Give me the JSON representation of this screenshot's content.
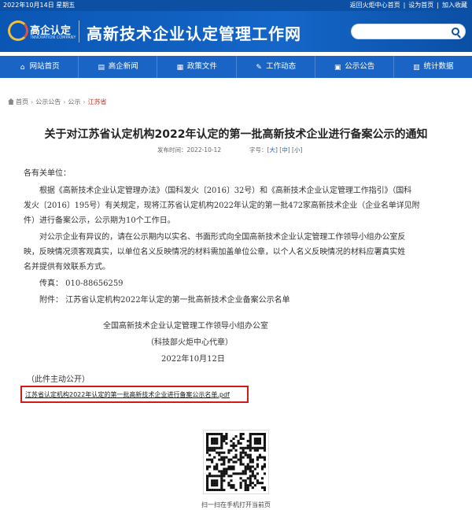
{
  "topbar": {
    "date": "2022年10月14日 星期五",
    "link_home": "返回火炬中心首页",
    "link_sethome": "设为首页",
    "link_favorite": "加入收藏"
  },
  "header": {
    "logo_text": "高企认定",
    "logo_sub": "INNOVATION COMPANY",
    "site_title": "高新技术企业认定管理工作网"
  },
  "nav": [
    {
      "label": "网站首页",
      "icon": "home-icon"
    },
    {
      "label": "高企新闻",
      "icon": "news-icon"
    },
    {
      "label": "政策文件",
      "icon": "document-icon"
    },
    {
      "label": "工作动态",
      "icon": "dynamics-icon"
    },
    {
      "label": "公示公告",
      "icon": "announcement-icon"
    },
    {
      "label": "统计数据",
      "icon": "statistics-icon"
    }
  ],
  "breadcrumb": {
    "home": "首页",
    "level1": "公示公告",
    "level2": "公示",
    "current": "江苏省"
  },
  "article": {
    "title": "关于对江苏省认定机构2022年认定的第一批高新技术企业进行备案公示的通知",
    "publish_label": "发布时间：",
    "publish_time": "2022-10-12",
    "font_label": "字号：",
    "font_large": "大",
    "font_medium": "中",
    "font_small": "小",
    "salutation": "各有关单位：",
    "p1_line1": "根据《高新技术企业认定管理办法》（国科发火〔2016〕32号）和《高新技术企业认定管理工作指引》（国科",
    "p1_line2": "发火〔2016〕195号）有关规定，现将江苏省认定机构2022年认定的第一批472家高新技术企业（企业名单详见附",
    "p1_line3": "件）进行备案公示，公示期为10个工作日。",
    "p2_line1": "对公示企业有异议的，请在公示期内以实名、书面形式向全国高新技术企业认定管理工作领导小组办公室反",
    "p2_line2": "映，反映情况须客观真实，以单位名义反映情况的材料需加盖单位公章，以个人名义反映情况的材料应署真实姓",
    "p2_line3": "名并提供有效联系方式。",
    "fax": "传真：  010-88656259",
    "attachment_label": "附件：  江苏省认定机构2022年认定的第一批高新技术企业备案公示名单",
    "sign1": "全国高新技术企业认定管理工作领导小组办公室",
    "sign2": "（科技部火炬中心代章）",
    "sign_date": "2022年10月12日",
    "public_note": "（此件主动公开）",
    "attachment_file": "江苏省认定机构2022年认定的第一批高新技术企业进行备案公示名单.pdf"
  },
  "qr": {
    "caption": "扫一扫在手机打开当前页"
  }
}
